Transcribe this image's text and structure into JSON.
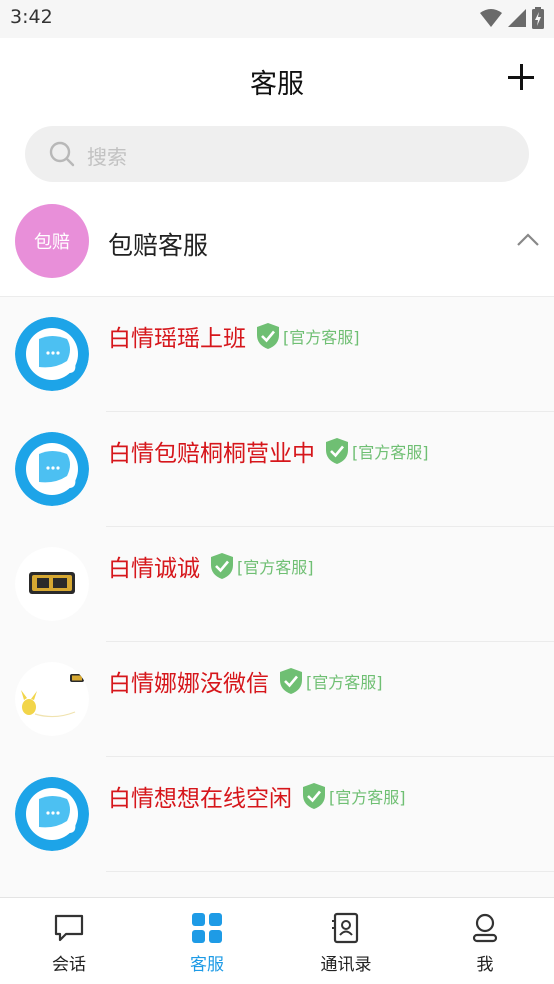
{
  "status_bar": {
    "time": "3:42"
  },
  "header": {
    "title": "客服"
  },
  "search": {
    "placeholder": "搜索"
  },
  "group": {
    "avatar_text": "包赔",
    "name": "包赔客服"
  },
  "contacts": [
    {
      "name": "白情瑶瑶上班",
      "tag": "[官方客服]",
      "avatar": "chat-bubble"
    },
    {
      "name": "白情包赔桐桐营业中",
      "tag": "[官方客服]",
      "avatar": "chat-bubble"
    },
    {
      "name": "白情诚诚",
      "tag": "[官方客服]",
      "avatar": "logo"
    },
    {
      "name": "白情娜娜没微信",
      "tag": "[官方客服]",
      "avatar": "pikachu"
    },
    {
      "name": "白情想想在线空闲",
      "tag": "[官方客服]",
      "avatar": "chat-bubble"
    }
  ],
  "bottom_nav": {
    "items": [
      {
        "label": "会话",
        "icon": "chat-icon"
      },
      {
        "label": "客服",
        "icon": "grid-icon",
        "active": true
      },
      {
        "label": "通讯录",
        "icon": "contacts-book-icon"
      },
      {
        "label": "我",
        "icon": "profile-icon"
      }
    ]
  },
  "colors": {
    "accent": "#1e9be6",
    "contact_name": "#d6161b",
    "verified": "#6fbf73",
    "group_avatar": "#e88fd9"
  }
}
